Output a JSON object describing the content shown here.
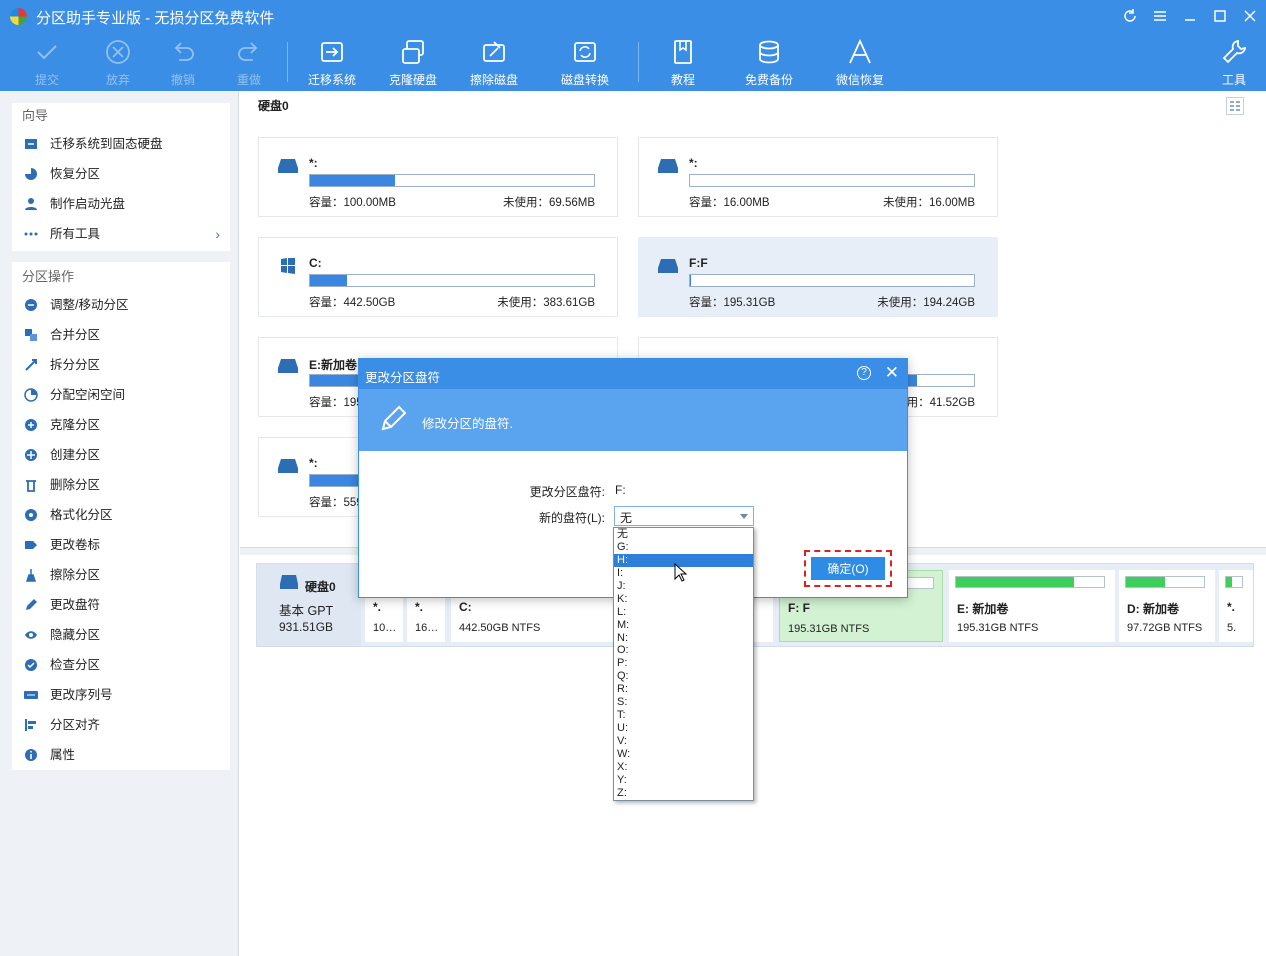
{
  "window": {
    "title": "分区助手专业版 - 无损分区免费软件"
  },
  "toolbar": {
    "commit": "提交",
    "discard": "放弃",
    "undo": "撤销",
    "redo": "重做",
    "migrate": "迁移系统",
    "clone_disk": "克隆硬盘",
    "wipe_disk": "擦除磁盘",
    "disk_convert": "磁盘转换",
    "tutorial": "教程",
    "free_backup": "免费备份",
    "wechat_recovery": "微信恢复",
    "tools": "工具"
  },
  "sidebar": {
    "wizard_title": "向导",
    "wizard_items": [
      "迁移系统到固态硬盘",
      "恢复分区",
      "制作启动光盘",
      "所有工具"
    ],
    "ops_title": "分区操作",
    "ops_items": [
      "调整/移动分区",
      "合并分区",
      "拆分分区",
      "分配空闲空间",
      "克隆分区",
      "创建分区",
      "删除分区",
      "格式化分区",
      "更改卷标",
      "擦除分区",
      "更改盘符",
      "隐藏分区",
      "检查分区",
      "更改序列号",
      "分区对齐",
      "属性"
    ]
  },
  "disk_header": "硬盘0",
  "cards": [
    {
      "name": "*:",
      "capacity": "容量：100.00MB",
      "free": "未使用：69.56MB",
      "used_fraction": 0.3,
      "icon": "disk-icon"
    },
    {
      "name": "*:",
      "capacity": "容量：16.00MB",
      "free": "未使用：16.00MB",
      "used_fraction": 0.0,
      "icon": "disk-icon"
    },
    {
      "name": "C:",
      "capacity": "容量：442.50GB",
      "free": "未使用：383.61GB",
      "used_fraction": 0.13,
      "icon": "windows-icon"
    },
    {
      "name": "F:F",
      "capacity": "容量：195.31GB",
      "free": "未使用：194.24GB",
      "used_fraction": 0.005,
      "icon": "disk-icon"
    },
    {
      "name": "E:新加卷",
      "capacity": "容量：195",
      "free": "用：41.52GB",
      "used_fraction": 0.8,
      "icon": "disk-icon"
    },
    {
      "name": "*:",
      "capacity": "容量：559",
      "free": "",
      "used_fraction": 0.5,
      "icon": "disk-icon"
    }
  ],
  "card_partial_name": "新加卷",
  "disk_map": {
    "disk_name": "硬盘0",
    "disk_type": "基本 GPT",
    "disk_size": "931.51GB",
    "partitions": [
      {
        "name": "*.",
        "info": "10…",
        "used_fraction": 0.3
      },
      {
        "name": "*.",
        "info": "16…",
        "used_fraction": 0.0
      },
      {
        "name": "C:",
        "info": "442.50GB NTFS",
        "used_fraction": 0.13
      },
      {
        "name": "F: F",
        "info": "195.31GB NTFS",
        "used_fraction": 0.0
      },
      {
        "name": "E: 新加卷",
        "info": "195.31GB NTFS",
        "used_fraction": 0.8
      },
      {
        "name": "D: 新加卷",
        "info": "97.72GB NTFS",
        "used_fraction": 0.5
      },
      {
        "name": "*.",
        "info": "5.",
        "used_fraction": 0.4
      }
    ]
  },
  "dialog": {
    "title": "更改分区盘符",
    "banner": "修改分区的盘符.",
    "label_change": "更改分区盘符:",
    "current_letter": "F:",
    "label_new": "新的盘符(L):",
    "selected": "无",
    "ok": "确定(O)",
    "options": [
      "无",
      "G:",
      "H:",
      "I:",
      "J:",
      "K:",
      "L:",
      "M:",
      "N:",
      "O:",
      "P:",
      "Q:",
      "R:",
      "S:",
      "T:",
      "U:",
      "V:",
      "W:",
      "X:",
      "Y:",
      "Z:"
    ],
    "highlighted": "H:"
  },
  "colors": {
    "accent": "#3a8ee6",
    "selected_partition": "#d3f2d3",
    "highlight": "#e02020"
  }
}
